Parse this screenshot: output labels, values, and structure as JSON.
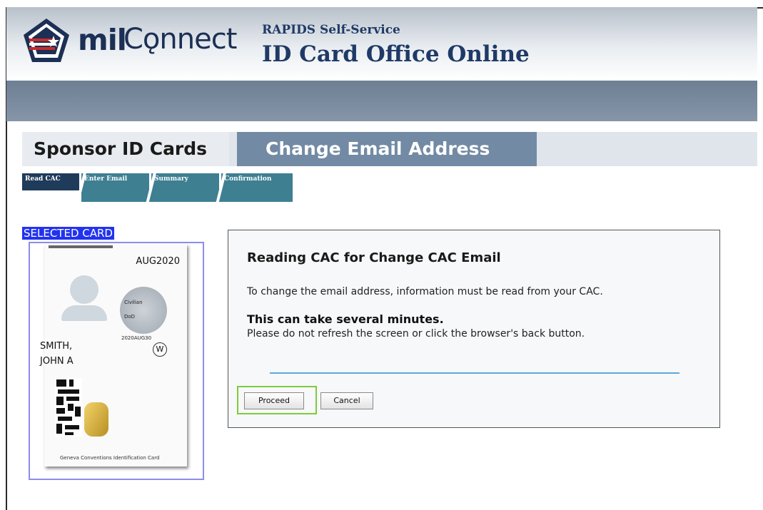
{
  "header": {
    "logo_mil": "mil",
    "logo_connect": "Cǫnnect",
    "subtitle_small": "RAPIDS Self-Service",
    "subtitle_big": "ID Card Office Online"
  },
  "tabs": {
    "sponsor": "Sponsor ID Cards",
    "change": "Change Email Address"
  },
  "steps": [
    "Read CAC",
    "Enter Email",
    "Summary",
    "Confirmation"
  ],
  "selected_label": "SELECTED CARD",
  "card": {
    "date": "AUG2020",
    "name_line1": "SMITH,",
    "name_line2": "JOHN A",
    "badge": "W",
    "tiny1": "Civilian",
    "tiny2": "DoD",
    "tiny3": "2020AUG30",
    "footer": "Geneva Conventions Identification Card"
  },
  "dialog": {
    "title": "Reading CAC for Change CAC Email",
    "p1": "To change the email address, information must be read from your CAC.",
    "p2": "This can take several minutes.",
    "p3": "Please do not refresh the screen or click the browser's back button.",
    "proceed": "Proceed",
    "cancel": "Cancel"
  },
  "colors": {
    "brand_navy": "#1c2f55",
    "active_tab": "#728aa4",
    "step_active": "#1f3b5a",
    "step_inactive": "#3e7f92",
    "selected_highlight": "#2233ee",
    "proceed_outline": "#7fcb3b"
  }
}
